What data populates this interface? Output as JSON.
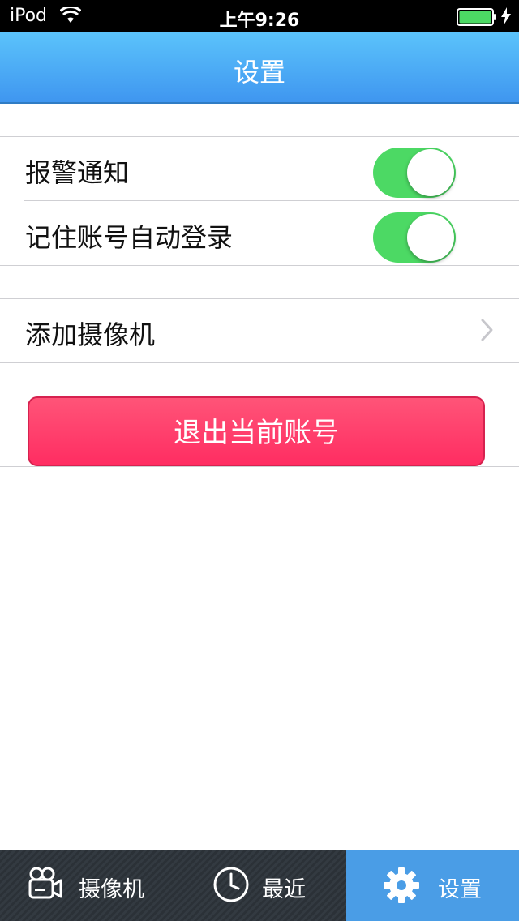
{
  "status_bar": {
    "carrier": "iPod",
    "time": "上午9:26"
  },
  "nav": {
    "title": "设置"
  },
  "settings": {
    "alarm_notification": {
      "label": "报警通知",
      "enabled": true
    },
    "remember_login": {
      "label": "记住账号自动登录",
      "enabled": true
    },
    "add_camera": {
      "label": "添加摄像机"
    },
    "logout_label": "退出当前账号"
  },
  "tabs": [
    {
      "label": "摄像机",
      "icon": "camera-icon",
      "active": false
    },
    {
      "label": "最近",
      "icon": "clock-icon",
      "active": false
    },
    {
      "label": "设置",
      "icon": "gear-icon",
      "active": true
    }
  ],
  "colors": {
    "nav_top": "#5bc3fb",
    "nav_bottom": "#3f96f0",
    "toggle_on": "#4cd964",
    "logout_button": "#ff2d62",
    "tab_active": "#4a9de6"
  }
}
